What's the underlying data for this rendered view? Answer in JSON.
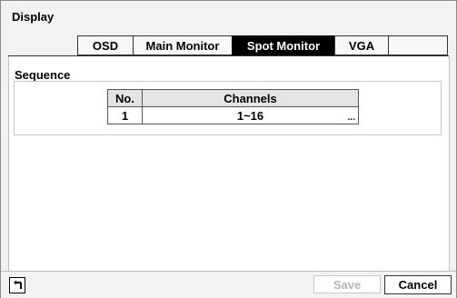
{
  "window": {
    "title": "Display"
  },
  "tabs": [
    {
      "label": "OSD",
      "active": false
    },
    {
      "label": "Main Monitor",
      "active": false
    },
    {
      "label": "Spot Monitor",
      "active": true
    },
    {
      "label": "VGA",
      "active": false
    },
    {
      "label": "",
      "active": false
    }
  ],
  "sequence": {
    "label": "Sequence",
    "columns": {
      "no": "No.",
      "channels": "Channels"
    },
    "rows": [
      {
        "no": "1",
        "channels": "1~16",
        "more": "..."
      }
    ]
  },
  "footer": {
    "back_icon": "back-arrow-icon",
    "save_label": "Save",
    "save_enabled": false,
    "cancel_label": "Cancel"
  },
  "colors": {
    "active_tab_bg": "#000000",
    "active_tab_text": "#ffffff",
    "disabled_text": "#b5b5b5"
  }
}
